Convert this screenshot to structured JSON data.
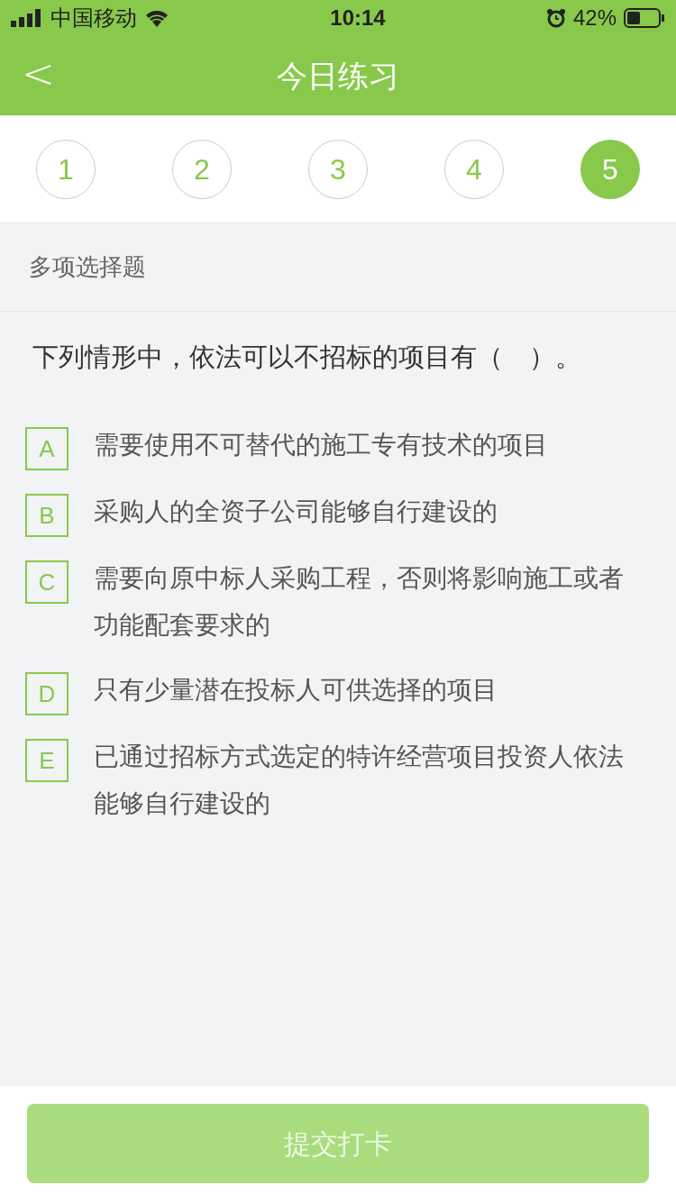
{
  "status_bar": {
    "carrier": "中国移动",
    "time": "10:14",
    "battery": "42%"
  },
  "nav": {
    "back": "<",
    "title": "今日练习"
  },
  "steps": [
    {
      "label": "1",
      "selected": false
    },
    {
      "label": "2",
      "selected": false
    },
    {
      "label": "3",
      "selected": false
    },
    {
      "label": "4",
      "selected": false
    },
    {
      "label": "5",
      "selected": true
    }
  ],
  "question_type": "多项选择题",
  "question": "下列情形中，依法可以不招标的项目有（　）。",
  "options": [
    {
      "letter": "A",
      "text": "需要使用不可替代的施工专有技术的项目",
      "checked": false
    },
    {
      "letter": "B",
      "text": "采购人的全资子公司能够自行建设的",
      "checked": false
    },
    {
      "letter": "C",
      "text": "需要向原中标人采购工程，否则将影响施工或者功能配套要求的",
      "checked": false
    },
    {
      "letter": "D",
      "text": "只有少量潜在投标人可供选择的项目",
      "checked": false
    },
    {
      "letter": "E",
      "text": "已通过招标方式选定的特许经营项目投资人依法能够自行建设的",
      "checked": false
    }
  ],
  "submit": {
    "label": "提交打卡",
    "disabled": true
  }
}
